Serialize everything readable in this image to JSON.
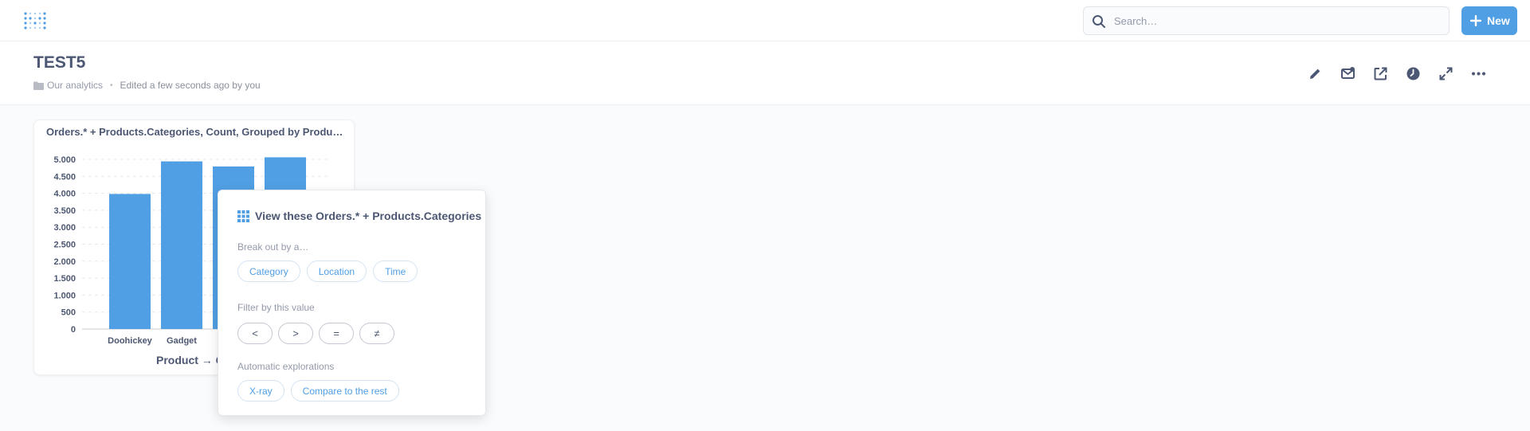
{
  "navbar": {
    "logo": "metabase-logo-icon",
    "search_placeholder": "Search…",
    "new_label": "New"
  },
  "dashboard": {
    "title": "TEST5",
    "collection": "Our analytics",
    "edited": "Edited a few seconds ago by you",
    "actions": [
      "pencil-icon",
      "subscription-icon",
      "share-icon",
      "history-icon",
      "fullscreen-icon",
      "more-icon"
    ]
  },
  "card": {
    "title": "Orders.* + Products.Categories, Count, Grouped by Produ…"
  },
  "chart_data": {
    "type": "bar",
    "categories": [
      "Doohickey",
      "Gadget",
      "",
      ""
    ],
    "values": [
      3980,
      4940,
      4790,
      5060
    ],
    "xlabel": "Product → C",
    "ylabel": "",
    "ylim": [
      0,
      5000
    ],
    "yticks": [
      "0",
      "500",
      "1.000",
      "1.500",
      "2.000",
      "2.500",
      "3.000",
      "3.500",
      "4.000",
      "4.500",
      "5.000"
    ],
    "color": "#509ee3",
    "grid": true
  },
  "popover": {
    "title": "View these Orders.* + Products.Categories",
    "breakout_label": "Break out by a…",
    "breakout_options": [
      "Category",
      "Location",
      "Time"
    ],
    "filter_label": "Filter by this value",
    "filter_options": [
      "<",
      ">",
      "=",
      "≠"
    ],
    "explore_label": "Automatic explorations",
    "explore_options": [
      "X-ray",
      "Compare to the rest"
    ]
  },
  "colors": {
    "brand": "#509ee3",
    "text": "#4c5773",
    "muted": "#949aab"
  }
}
